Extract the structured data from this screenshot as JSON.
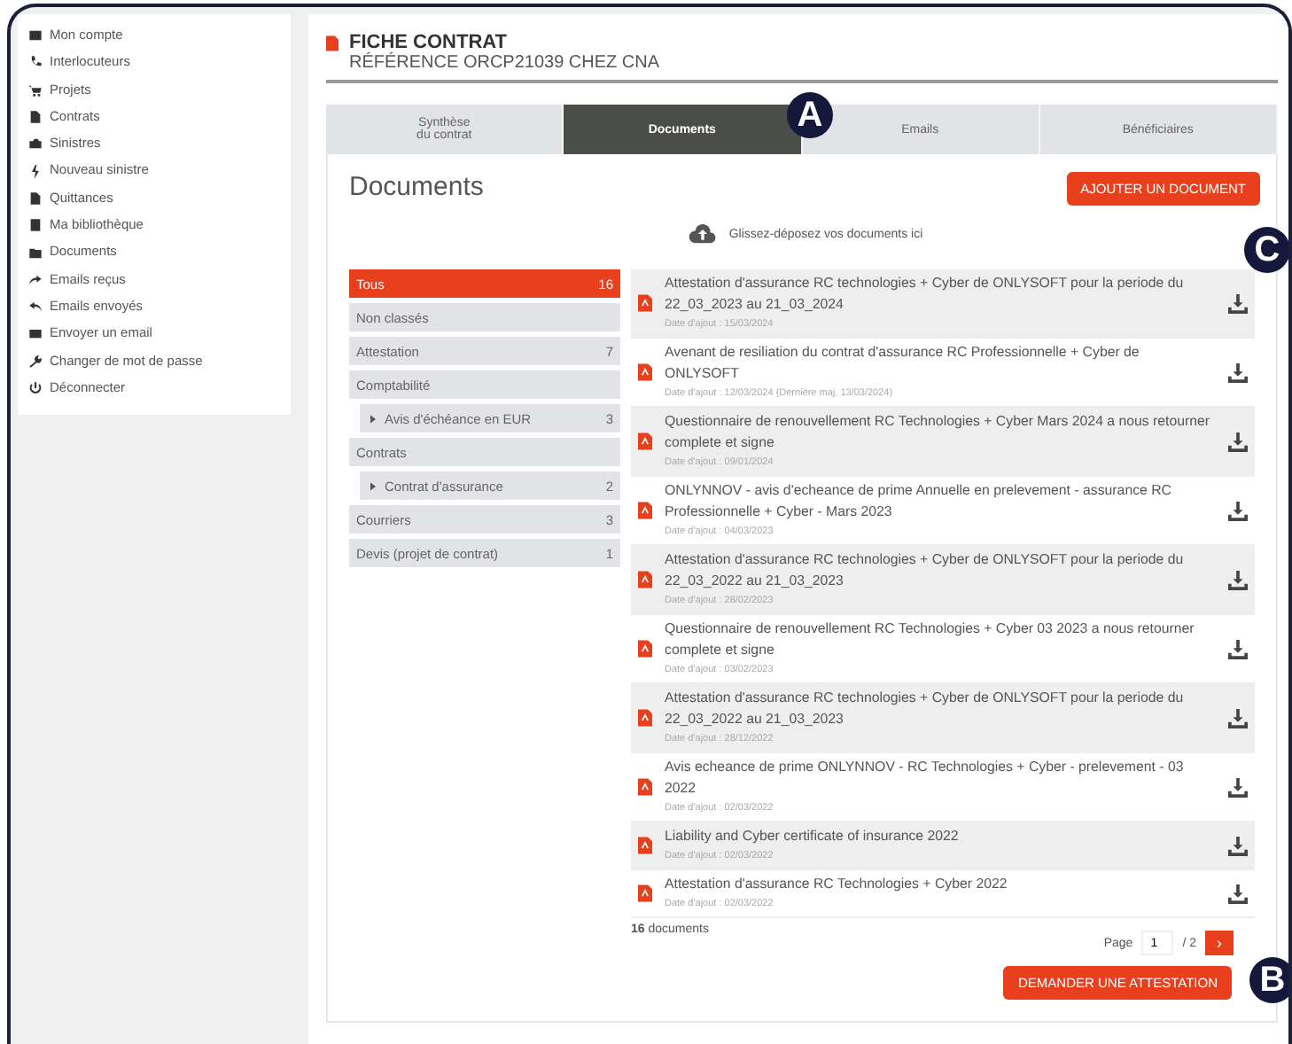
{
  "sidebar": {
    "items": [
      {
        "label": "Mon compte"
      },
      {
        "label": "Interlocuteurs"
      },
      {
        "label": "Projets"
      },
      {
        "label": "Contrats"
      },
      {
        "label": "Sinistres"
      },
      {
        "label": "Nouveau sinistre"
      },
      {
        "label": "Quittances"
      },
      {
        "label": "Ma bibliothèque"
      },
      {
        "label": "Documents"
      },
      {
        "label": "Emails reçus"
      },
      {
        "label": "Emails envoyés"
      },
      {
        "label": "Envoyer un email"
      },
      {
        "label": "Changer de mot de passe"
      },
      {
        "label": "Déconnecter"
      }
    ]
  },
  "header": {
    "title": "FICHE CONTRAT",
    "subtitle": "RÉFÉRENCE ORCP21039 CHEZ CNA"
  },
  "tabs": [
    {
      "label": "Synthèse\ndu contrat",
      "selected": false
    },
    {
      "label": "Documents",
      "selected": true
    },
    {
      "label": "Emails",
      "selected": false
    },
    {
      "label": "Bénéficiaires",
      "selected": false
    }
  ],
  "section_title": "Documents",
  "add_button": "AJOUTER UN DOCUMENT",
  "dropzone": "Glissez-déposez vos documents ici",
  "categories": [
    {
      "label": "Tous",
      "count": "16",
      "selected": true
    },
    {
      "label": "Non classés",
      "selected": false
    },
    {
      "label": "Attestation",
      "count": "7",
      "selected": false
    },
    {
      "label": "Comptabilité",
      "selected": false,
      "children": [
        {
          "label": "Avis d'échéance en EUR",
          "count": "3",
          "selected": false
        }
      ]
    },
    {
      "label": "Contrats",
      "selected": false,
      "children": [
        {
          "label": "Contrat d'assurance",
          "count": "2",
          "selected": false
        }
      ]
    },
    {
      "label": "Courriers",
      "count": "3",
      "selected": false
    },
    {
      "label": "Devis (projet de contrat)",
      "count": "1",
      "selected": false
    }
  ],
  "documents": [
    {
      "title": "Attestation d'assurance RC technologies + Cyber de ONLYSOFT pour la periode du 22_03_2023 au 21_03_2024",
      "date": "Date d'ajout : 15/03/2024"
    },
    {
      "title": "Avenant de resiliation du contrat d'assurance RC Professionnelle + Cyber de ONLYSOFT",
      "date": "Date d'ajout : 12/03/2024 (Dernière maj. 13/03/2024)"
    },
    {
      "title": "Questionnaire de renouvellement RC Technologies + Cyber Mars 2024 a nous retourner complete et signe",
      "date": "Date d'ajout : 09/01/2024"
    },
    {
      "title": "ONLYNNOV - avis d'echeance de prime Annuelle en prelevement - assurance RC Professionnelle + Cyber - Mars 2023",
      "date": "Date d'ajout : 04/03/2023"
    },
    {
      "title": "Attestation d'assurance RC technologies + Cyber de ONLYSOFT pour la periode du 22_03_2022 au 21_03_2023",
      "date": "Date d'ajout : 28/02/2023"
    },
    {
      "title": "Questionnaire de renouvellement RC Technologies + Cyber 03 2023 a nous retourner complete et signe",
      "date": "Date d'ajout : 03/02/2023"
    },
    {
      "title": "Attestation d'assurance RC technologies + Cyber de ONLYSOFT pour la periode du 22_03_2022 au 21_03_2023",
      "date": "Date d'ajout : 28/12/2022"
    },
    {
      "title": "Avis echeance de prime ONLYNNOV - RC Technologies + Cyber - prelevement - 03 2022",
      "date": "Date d'ajout : 02/03/2022"
    },
    {
      "title": "Liability and Cyber certificate of insurance 2022",
      "date": "Date d'ajout : 02/03/2022"
    },
    {
      "title": "Attestation d'assurance RC Technologies + Cyber 2022",
      "date": "Date d'ajout : 02/03/2022"
    }
  ],
  "count": {
    "number": "16",
    "label": "documents"
  },
  "pager": {
    "label": "Page",
    "value": "1",
    "total": "/ 2",
    "next": "›"
  },
  "request_button": "DEMANDER UNE ATTESTATION",
  "callouts": [
    {
      "label": "A"
    },
    {
      "label": "B"
    },
    {
      "label": "C"
    }
  ]
}
